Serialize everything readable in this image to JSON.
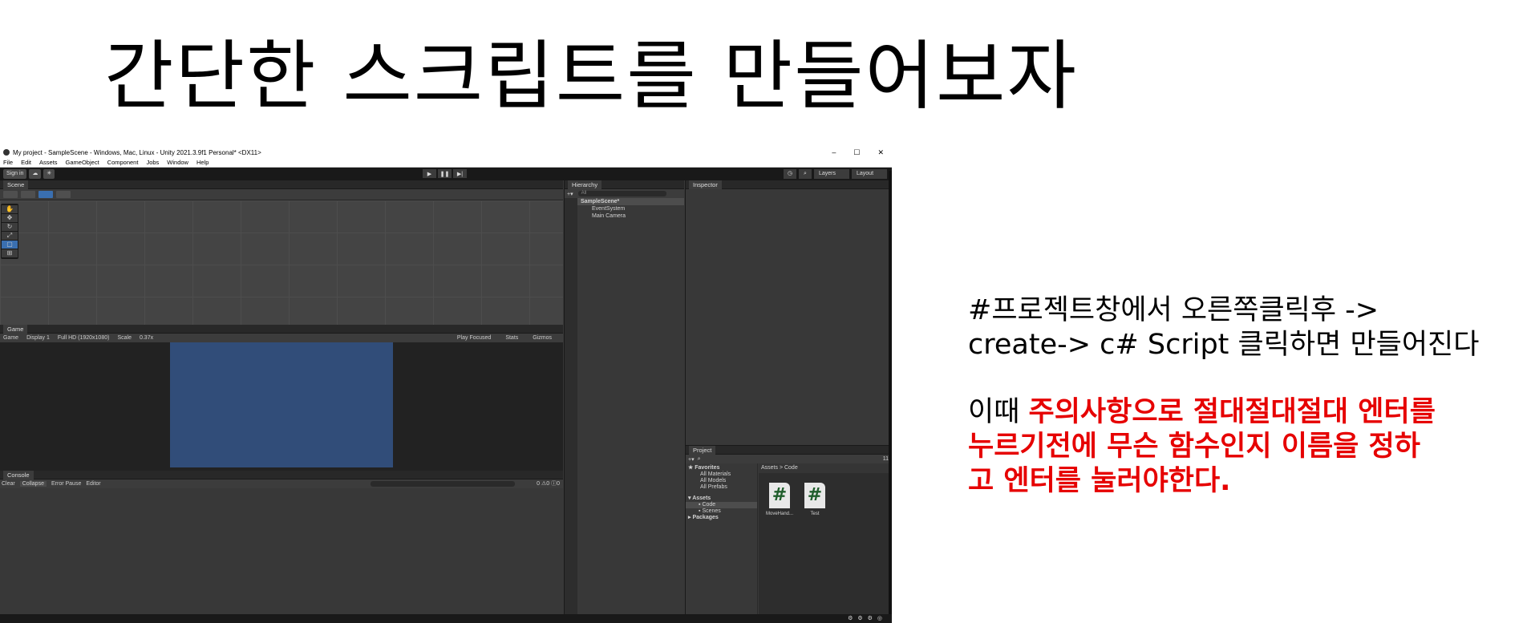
{
  "slide": {
    "title": "간단한 스크립트를 만들어보자",
    "note_line1": "#프로젝트창에서 오른쪽클릭후 ->",
    "note_line2": "create-> c# Script 클릭하면 만들어진다",
    "note2_prefix": "이때 ",
    "note2_red1": "주의사항으로 절대절대절대 엔터를",
    "note2_red2": "누르기전에 무슨 함수인지 이름을 정하",
    "note2_red3": "고 엔터를 눌러야한다.",
    "red_color": "#e60000"
  },
  "unity": {
    "window_title": "My project - SampleScene - Windows, Mac, Linux - Unity 2021.3.9f1 Personal* <DX11>",
    "win_controls": [
      "–",
      "☐",
      "✕"
    ],
    "menu": [
      "File",
      "Edit",
      "Assets",
      "GameObject",
      "Component",
      "Jobs",
      "Window",
      "Help"
    ],
    "toolbar": {
      "sign_in": "Sign in",
      "layers": "Layers",
      "layout": "Layout"
    },
    "scene_tab": "Scene",
    "game": {
      "tab": "Game",
      "mode": "Game",
      "display": "Display 1",
      "resolution": "Full HD (1920x1080)",
      "scale_label": "Scale",
      "scale_value": "0.37x",
      "play_focused": "Play Focused",
      "stats": "Stats",
      "gizmos": "Gizmos"
    },
    "console": {
      "tab": "Console",
      "clear": "Clear",
      "collapse": "Collapse",
      "error_pause": "Error Pause",
      "editor": "Editor",
      "counts": "0  ⚠0  ⓘ0"
    },
    "hierarchy": {
      "tab": "Hierarchy",
      "search_placeholder": "All",
      "scene": "SampleScene*",
      "children": [
        "EventSystem",
        "Main Camera"
      ]
    },
    "inspector": {
      "tab": "Inspector"
    },
    "project": {
      "tab": "Project",
      "favorites": "Favorites",
      "fav_items": [
        "All Materials",
        "All Models",
        "All Prefabs"
      ],
      "assets": "Assets",
      "asset_items": [
        "Code",
        "Scenes"
      ],
      "packages": "Packages",
      "breadcrumb": "Assets > Code",
      "files": [
        {
          "name": "MoveHand...",
          "glyph": "#"
        },
        {
          "name": "Test",
          "glyph": "#"
        }
      ],
      "badge": "11"
    },
    "colors": {
      "editor_bg": "#383838",
      "game_bg": "#314d79",
      "selection": "#3a6fb0"
    }
  }
}
